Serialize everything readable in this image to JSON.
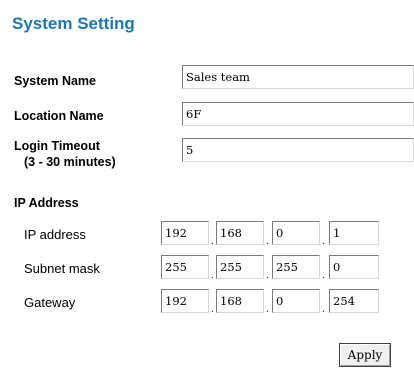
{
  "page": {
    "title": "System Setting"
  },
  "fields": {
    "system_name": {
      "label": "System Name",
      "value": "Sales team"
    },
    "location_name": {
      "label": "Location Name",
      "value": "6F"
    },
    "login_timeout": {
      "label_line1": "Login Timeout",
      "label_line2": "(3 - 30 minutes)",
      "value": "5"
    }
  },
  "ip_section": {
    "heading": "IP Address",
    "rows": [
      {
        "label": "IP address",
        "octets": [
          "192",
          "168",
          "0",
          "1"
        ]
      },
      {
        "label": "Subnet mask",
        "octets": [
          "255",
          "255",
          "255",
          "0"
        ]
      },
      {
        "label": "Gateway",
        "octets": [
          "192",
          "168",
          "0",
          "254"
        ]
      }
    ],
    "separator": "."
  },
  "actions": {
    "apply_label": "Apply"
  },
  "colors": {
    "title": "#1a76b7"
  }
}
